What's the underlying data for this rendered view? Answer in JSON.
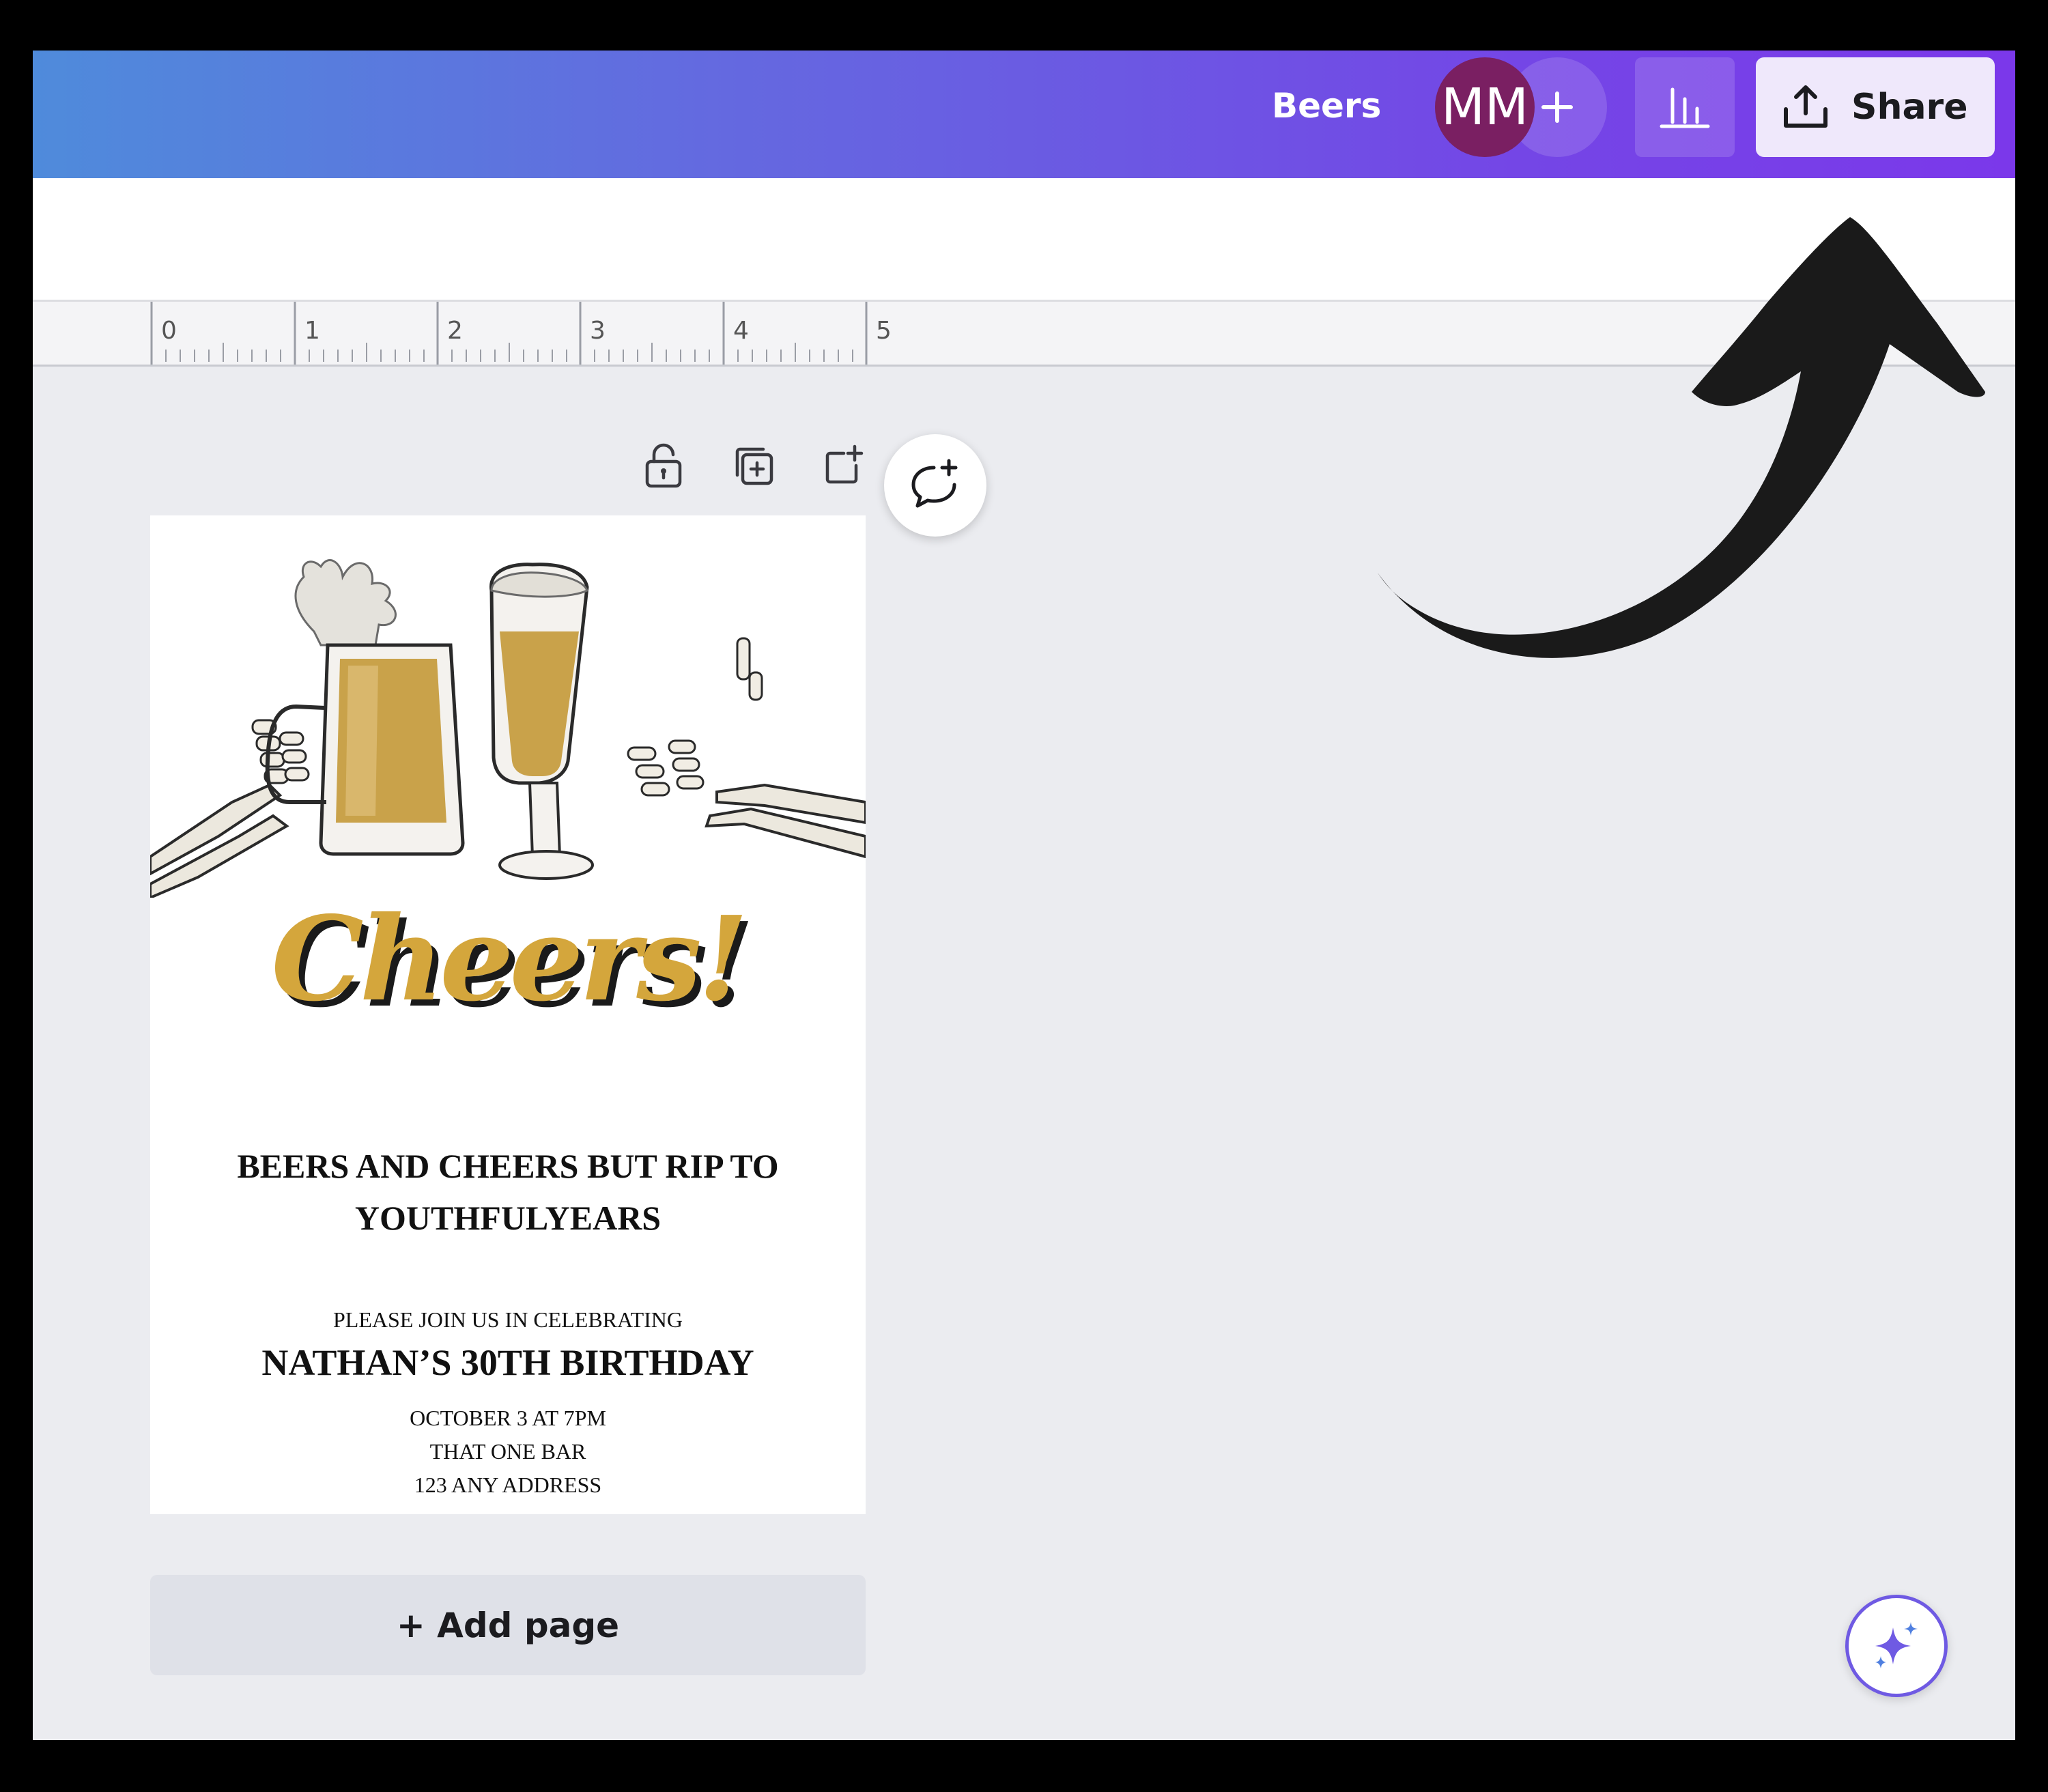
{
  "topbar": {
    "document_title": "Beers",
    "avatar_initials": "MM",
    "add_collaborator_icon": "plus-icon",
    "analytics_icon": "bar-chart-icon",
    "share_label": "Share",
    "share_icon": "upload-icon"
  },
  "ruler": {
    "marks": [
      "0",
      "1",
      "2",
      "3",
      "4",
      "5"
    ]
  },
  "page_actions": {
    "lock_icon": "lock-icon",
    "duplicate_icon": "duplicate-page-icon",
    "add_page_icon": "add-page-icon",
    "comment_icon": "add-comment-icon"
  },
  "invitation": {
    "script_title": "Cheers!",
    "heading_line1": "BEERS AND CHEERS BUT RIP TO",
    "heading_line2": "YOUTHFULYEARS",
    "subheading": "PLEASE JOIN US IN CELEBRATING",
    "celebrant": "NATHAN’S 30TH BIRTHDAY",
    "date_time": "OCTOBER 3 AT 7PM",
    "venue": "THAT ONE BAR",
    "address": "123 ANY ADDRESS"
  },
  "add_page_label": "+ Add page",
  "magic_icon": "sparkle-icon",
  "colors": {
    "topbar_gradient_start": "#4f8bdb",
    "topbar_gradient_end": "#7b38ea",
    "avatar_bg": "#7a1f62",
    "share_bg": "#efe8fb",
    "canvas_bg": "#ebecf0",
    "cheers_gold": "#d4a63c"
  }
}
